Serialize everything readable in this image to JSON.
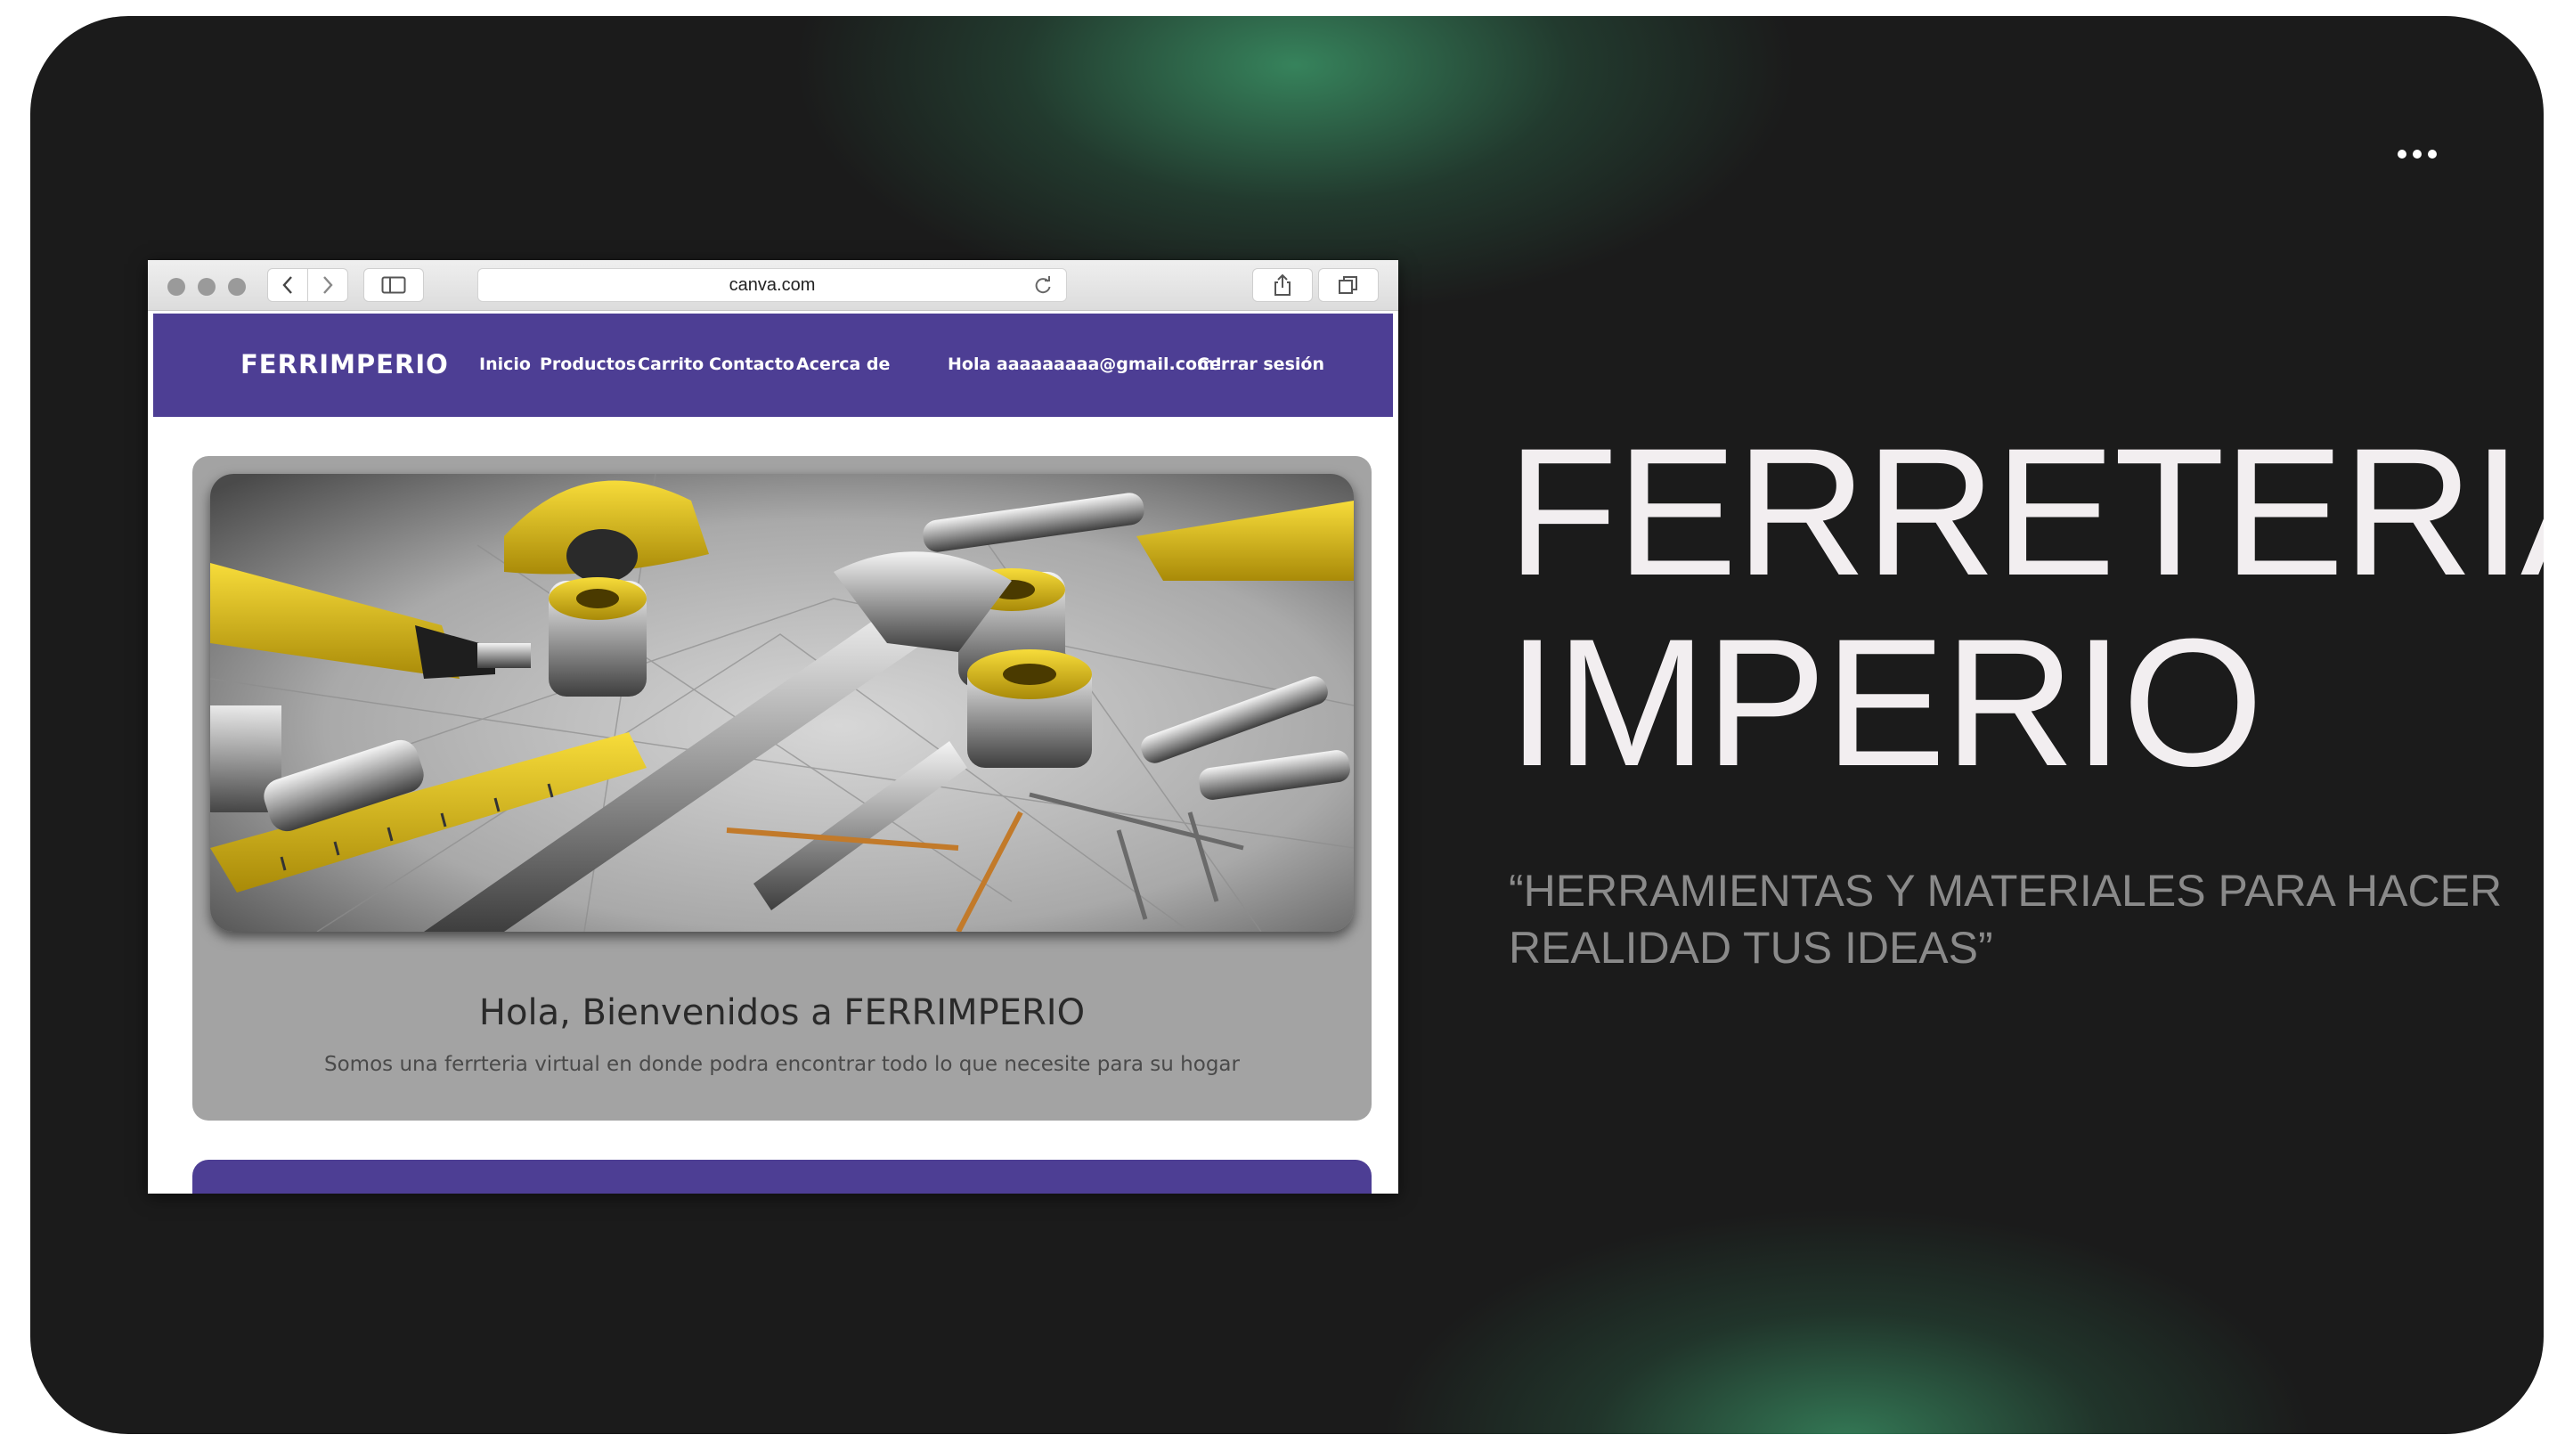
{
  "browser": {
    "url": "canva.com"
  },
  "site": {
    "brand": "FERRIMPERIO",
    "nav": [
      "Inicio",
      "Productos",
      "Carrito",
      "Contacto",
      "Acerca de"
    ],
    "greeting": "Hola aaaaaaaaa@gmail.com!",
    "logout": "Cerrar sesión",
    "nav_color": "#4d3e94"
  },
  "hero": {
    "heading": "Hola, Bienvenidos a FERRIMPERIO",
    "subtext": "Somos una ferrteria virtual en donde podra encontrar todo lo que necesite para su hogar",
    "image": "hardware-tools-photo"
  },
  "slide": {
    "title_line1": "FERRETERIA",
    "title_line2": "IMPERIO",
    "tagline": "“HERRAMIENTAS Y MATERIALES PARA HACER REALIDAD TUS IDEAS”",
    "background": "#1b1b1b",
    "accent": "#3fa06e"
  },
  "icons": {
    "more": "more-options-icon",
    "back": "chevron-left-icon",
    "forward": "chevron-right-icon",
    "sidebar": "sidebar-icon",
    "reload": "reload-icon",
    "share": "share-icon",
    "tabs": "tabs-icon"
  }
}
